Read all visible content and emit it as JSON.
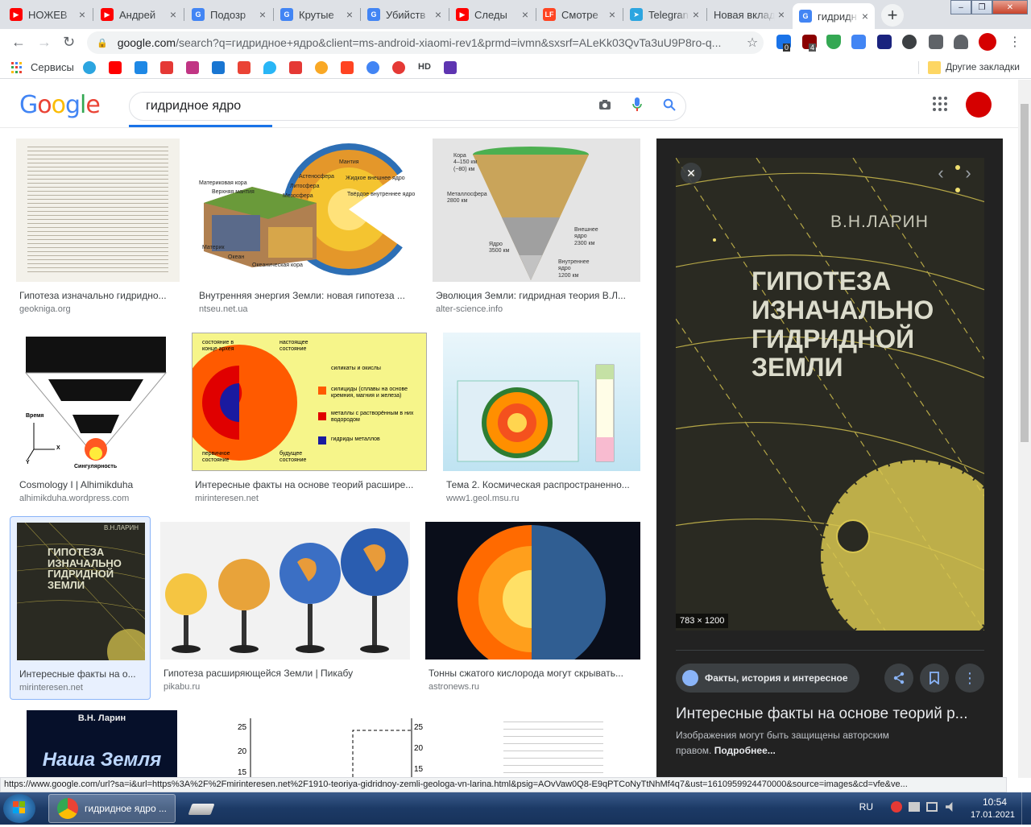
{
  "browser": {
    "tabs": [
      {
        "label": "НОЖЕВ",
        "fav_color": "#ff0000",
        "fav_text": "▶"
      },
      {
        "label": "Андрей",
        "fav_color": "#ff0000",
        "fav_text": "▶"
      },
      {
        "label": "Подозр",
        "fav_color": "#4285f4",
        "fav_text": "G"
      },
      {
        "label": "Крутые",
        "fav_color": "#4285f4",
        "fav_text": "G"
      },
      {
        "label": "Убийств",
        "fav_color": "#4285f4",
        "fav_text": "G"
      },
      {
        "label": "Следы",
        "fav_color": "#ff0000",
        "fav_text": "▶"
      },
      {
        "label": "Смотре",
        "fav_color": "#ff4422",
        "fav_text": "LF"
      },
      {
        "label": "Telegran",
        "fav_color": "#2ca5e0",
        "fav_text": "➤"
      },
      {
        "label": "Новая вклад",
        "fav_color": "",
        "fav_text": ""
      },
      {
        "label": "гидридн",
        "fav_color": "#4285f4",
        "fav_text": "G"
      }
    ],
    "new_tab": "+",
    "window_controls": [
      "–",
      "❐",
      "✕"
    ],
    "nav": {
      "back": "←",
      "forward": "→",
      "reload": "↻"
    },
    "url_host": "google.com",
    "url_rest": "/search?q=гидридное+ядро&client=ms-android-xiaomi-rev1&prmd=ivmn&sxsrf=ALeKk03QvTa3uU9P8ro-q...",
    "star": "☆",
    "ext_badges": [
      "0",
      "4"
    ],
    "bookmarks_apps": "Сервисы",
    "bookmarks_hd": "HD",
    "bookmarks_other": "Другие закладки"
  },
  "google": {
    "logo": [
      "G",
      "o",
      "o",
      "g",
      "l",
      "e"
    ],
    "logo_colors": [
      "#4285f4",
      "#ea4335",
      "#fbbc05",
      "#4285f4",
      "#34a853",
      "#ea4335"
    ],
    "query": "гидридное ядро",
    "camera_icon": "📷",
    "mic_icon": "🎤",
    "search_icon": "🔍"
  },
  "results": [
    {
      "caption": "Гипотеза изначально гидридно...",
      "source": "geokniga.org"
    },
    {
      "caption": "Внутренняя энергия Земли: новая гипотеза ...",
      "source": "ntseu.net.ua"
    },
    {
      "caption": "Эволюция Земли: гидридная теория В.Л...",
      "source": "alter-science.info"
    },
    {
      "caption": "Cosmology I | Alhimikduha",
      "source": "alhimikduha.wordpress.com"
    },
    {
      "caption": "Интересные факты на основе теорий расшире...",
      "source": "mirinteresen.net"
    },
    {
      "caption": "Тема 2. Космическая распространенно...",
      "source": "www1.geol.msu.ru"
    },
    {
      "caption": "Интересные факты на о...",
      "source": "mirinteresen.net"
    },
    {
      "caption": "Гипотеза расширяющейся Земли | Пикабу",
      "source": "pikabu.ru"
    },
    {
      "caption": "Тонны сжатого кислорода могут скрывать...",
      "source": "astronews.ru"
    }
  ],
  "thumb_text": {
    "cone_labels": [
      "Кора\n4–150 км\n(~80) км",
      "Металлосфера\n2800 км",
      "Внешнее\nядро\n2300 км",
      "Ядро\n3500 км",
      "Внутреннее\nядро\n1200 км"
    ],
    "earth_labels": [
      "Материковая кора",
      "Верхняя мантия",
      "Астеносфера",
      "Литосфера",
      "Мезосфера",
      "Мантия",
      "Жидкое внешнее ядро",
      "Твёрдое внутреннее ядро",
      "Материк",
      "Океан",
      "Океаническая кора"
    ],
    "cosmo_labels": [
      "Время",
      "X",
      "Y",
      "Сингулярность"
    ],
    "yellow_labels": [
      "состояние в конце архея",
      "настоящее состояние",
      "первичное состояние",
      "будущее состояние"
    ],
    "yellow_legend": [
      "силикаты и окислы",
      "силициды (сплавы на основе кремния, магния и железа)",
      "металлы с растворённым в них водородом",
      "гидриды металлов"
    ],
    "book_small": [
      "В.Н.ЛАРИН",
      "ГИПОТЕЗА",
      "ИЗНАЧАЛЬНО",
      "ГИДРИДНОЙ",
      "ЗЕМЛИ"
    ],
    "bottom_book": [
      "В.Н. Ларин",
      "Наша Земля"
    ],
    "graph_ticks": [
      "25",
      "20",
      "15"
    ]
  },
  "panel": {
    "author": "В.Н.ЛАРИН",
    "book_title": [
      "ГИПОТЕЗА",
      "ИЗНАЧАЛЬНО",
      "ГИДРИДНОЙ",
      "ЗЕМЛИ"
    ],
    "size_badge": "783 × 1200",
    "close": "✕",
    "prev": "‹",
    "next": "›",
    "source_chip": "Факты, история и интересное",
    "title": "Интересные факты на основе теорий р...",
    "notice": "Изображения могут быть защищены авторским правом.",
    "more": "Подробнее..."
  },
  "status_url": "https://www.google.com/url?sa=i&url=https%3A%2F%2Fmirinteresen.net%2F1910-teoriya-gidridnoy-zemli-geologa-vn-larina.html&psig=AOvVaw0Q8-E9qPTCoNyTtNhMf4q7&ust=1610959924470000&source=images&cd=vfe&ve...",
  "taskbar": {
    "chrome_task": "гидридное ядро ...",
    "lang": "RU",
    "time": "10:54",
    "date": "17.01.2021"
  }
}
